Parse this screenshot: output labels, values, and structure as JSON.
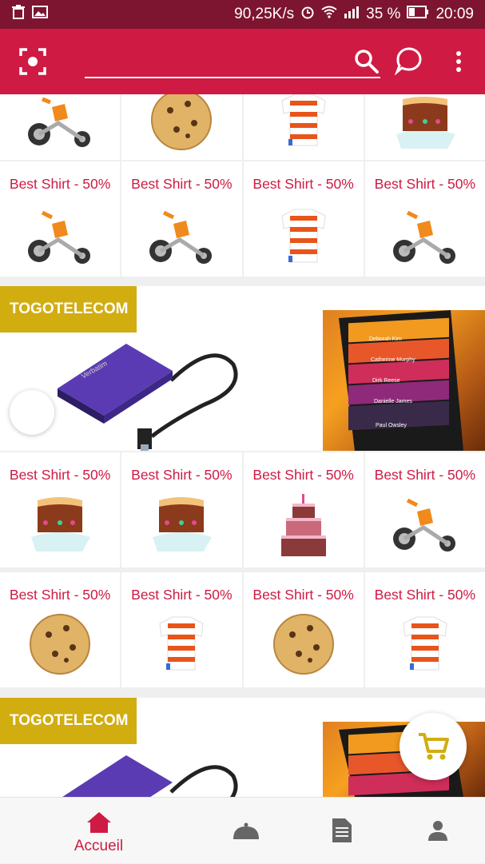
{
  "status_bar": {
    "speed": "90,25K/s",
    "battery": "35 %",
    "time": "20:09"
  },
  "search": {
    "placeholder": ""
  },
  "product_label": "Best Shirt - 50%",
  "sections": [
    {
      "tag": "TOGOTELECOM"
    },
    {
      "tag": "TOGOTELECOM"
    }
  ],
  "phone_contacts": [
    "Deborah Kim",
    "Catherine Murphy",
    "Dirk Reese",
    "Danielle James",
    "Paul Owsley"
  ],
  "drive_brand": "Verbatim",
  "bottom_nav": {
    "home_label": "Accueil"
  },
  "colors": {
    "primary": "#cf1a43",
    "status": "#7d1530",
    "tag": "#d1ad10"
  }
}
